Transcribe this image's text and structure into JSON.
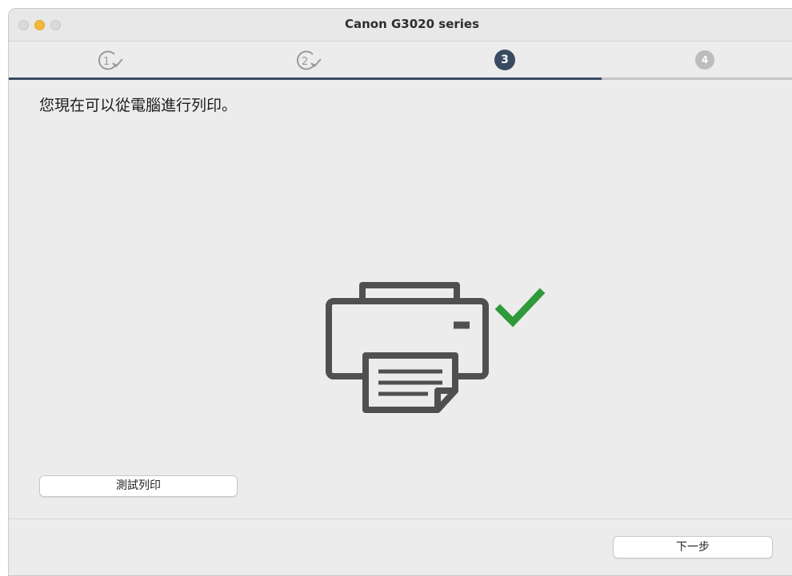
{
  "window": {
    "title": "Canon G3020 series"
  },
  "steps": [
    {
      "label": "1",
      "state": "done"
    },
    {
      "label": "2",
      "state": "done"
    },
    {
      "label": "3",
      "state": "active"
    },
    {
      "label": "4",
      "state": "upcoming"
    }
  ],
  "progress": {
    "fraction": 0.75,
    "color": "#3a4a63"
  },
  "main": {
    "message": "您現在可以從電腦進行列印。",
    "illustration_icons": [
      "printer-icon",
      "checkmark-icon"
    ],
    "check_color": "#2e9a3a"
  },
  "buttons": {
    "test_print": "測試列印",
    "next": "下一步"
  }
}
